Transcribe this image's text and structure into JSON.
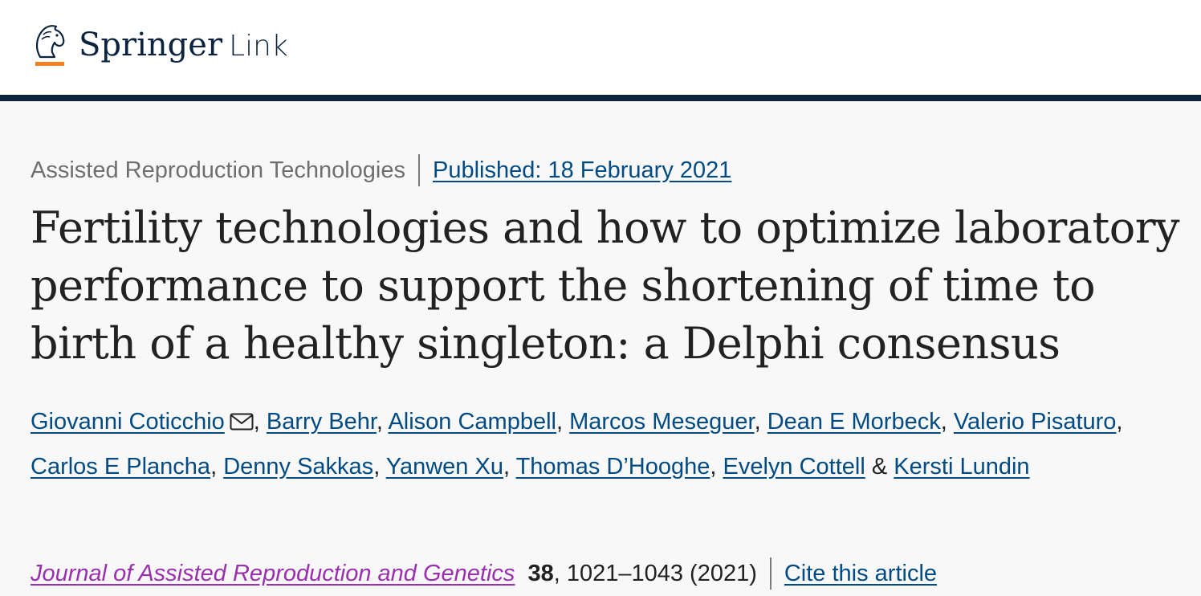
{
  "header": {
    "logo_springer": "Springer",
    "logo_link": "Link",
    "brand_color": "#0c2340",
    "accent_color": "#f58220"
  },
  "article": {
    "category": "Assisted Reproduction Technologies",
    "published": "Published: 18 February 2021",
    "title": "Fertility technologies and how to optimize laboratory performance to support the shortening of time to birth of a healthy singleton: a Delphi consensus",
    "authors": [
      "Giovanni Coticchio",
      "Barry Behr",
      "Alison Campbell",
      "Marcos Meseguer",
      "Dean E Morbeck",
      "Valerio Pisaturo",
      "Carlos E Plancha",
      "Denny Sakkas",
      "Yanwen Xu",
      "Thomas D’Hooghe",
      "Evelyn Cottell",
      "Kersti Lundin"
    ],
    "separator_comma": ", ",
    "separator_and": " & ",
    "contact_icon": "mail-icon"
  },
  "citation": {
    "journal": "Journal of Assisted Reproduction and Genetics",
    "volume": "38",
    "pages_year": ", 1021–1043 (2021)",
    "cite_label": "Cite this article"
  }
}
